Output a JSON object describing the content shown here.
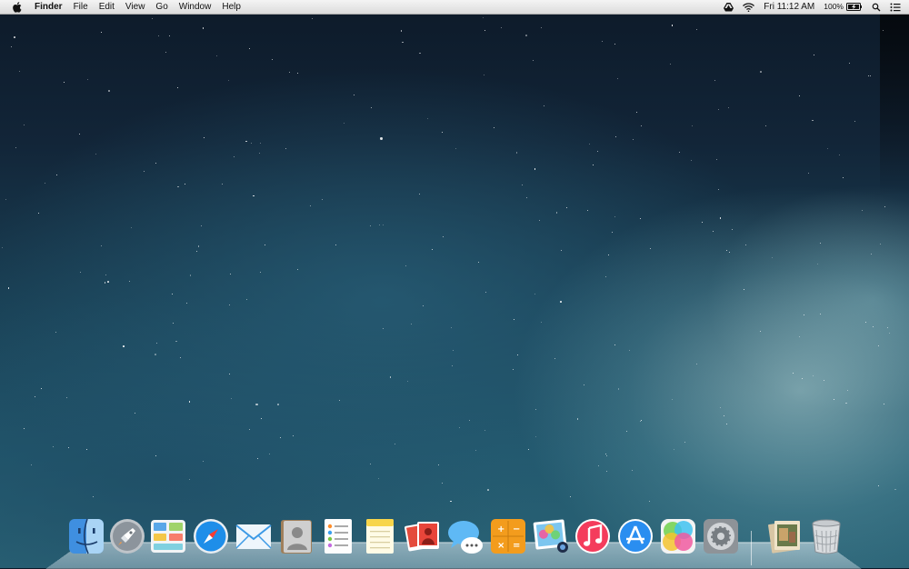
{
  "menubar": {
    "apple_icon": "apple-logo-icon",
    "app_name": "Finder",
    "menus": [
      "File",
      "Edit",
      "View",
      "Go",
      "Window",
      "Help"
    ],
    "status": {
      "clock": "Fri 11:12 AM",
      "battery": "100%"
    }
  },
  "dock": {
    "apps": [
      {
        "name": "Finder",
        "icon": "finder-icon"
      },
      {
        "name": "Launchpad",
        "icon": "launchpad-icon"
      },
      {
        "name": "Mission Control",
        "icon": "mission-control-icon"
      },
      {
        "name": "Safari",
        "icon": "safari-icon"
      },
      {
        "name": "Mail",
        "icon": "mail-icon"
      },
      {
        "name": "Contacts",
        "icon": "contacts-icon"
      },
      {
        "name": "Reminders",
        "icon": "reminders-icon"
      },
      {
        "name": "Notes",
        "icon": "notes-icon"
      },
      {
        "name": "Photo Booth",
        "icon": "photo-booth-icon"
      },
      {
        "name": "Messages",
        "icon": "messages-icon"
      },
      {
        "name": "Calculator",
        "icon": "calculator-icon"
      },
      {
        "name": "iPhoto",
        "icon": "iphoto-icon"
      },
      {
        "name": "iTunes",
        "icon": "itunes-icon"
      },
      {
        "name": "App Store",
        "icon": "app-store-icon"
      },
      {
        "name": "Game Center",
        "icon": "game-center-icon"
      },
      {
        "name": "System Preferences",
        "icon": "system-preferences-icon"
      }
    ],
    "others": [
      {
        "name": "Documents",
        "icon": "documents-stack-icon"
      },
      {
        "name": "Trash",
        "icon": "trash-icon"
      }
    ]
  }
}
